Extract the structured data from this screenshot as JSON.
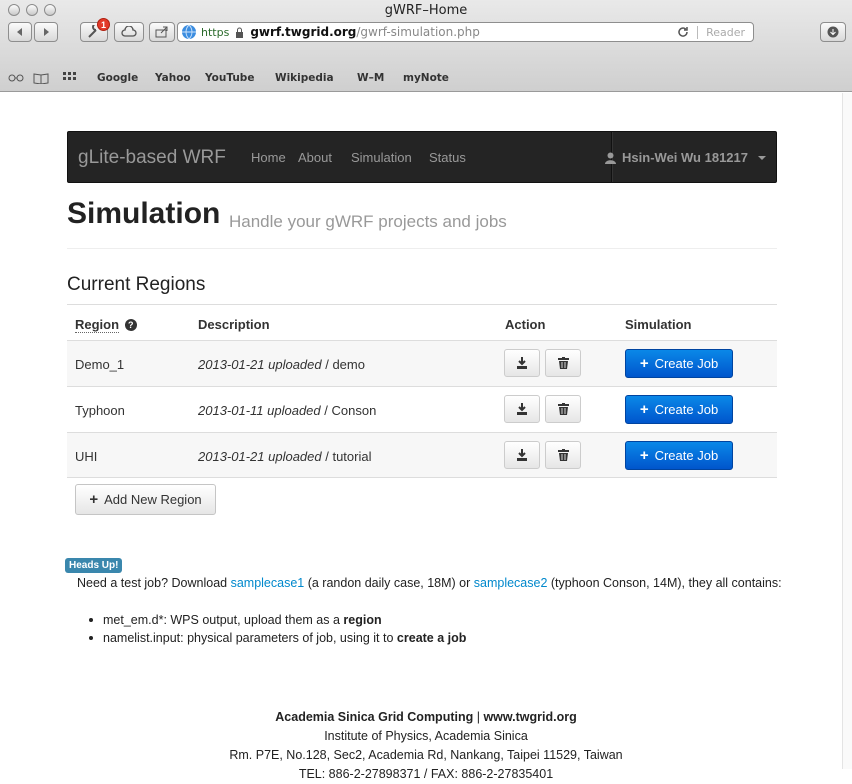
{
  "window": {
    "title": "gWRF–Home"
  },
  "toolbar": {
    "badge_count": "1",
    "url_scheme_label": "https",
    "url_host": "gwrf.twgrid.org",
    "url_path": "/gwrf-simulation.php",
    "reader_label": "Reader"
  },
  "bookmarks": [
    "Google",
    "Yahoo",
    "YouTube",
    "Wikipedia",
    "W–M",
    "myNote"
  ],
  "navbar": {
    "brand": "gLite-based WRF",
    "links": [
      "Home",
      "About",
      "Simulation",
      "Status"
    ],
    "user": "Hsin-Wei Wu 181217"
  },
  "header": {
    "title": "Simulation",
    "subtitle": "Handle your gWRF projects and jobs"
  },
  "regions": {
    "title": "Current Regions",
    "columns": [
      "Region",
      "Description",
      "Action",
      "Simulation"
    ],
    "rows": [
      {
        "region": "Demo_1",
        "date": "2013-01-21 uploaded",
        "sep": " / ",
        "desc": "demo",
        "create_label": "Create Job"
      },
      {
        "region": "Typhoon",
        "date": "2013-01-11 uploaded",
        "sep": " / ",
        "desc": "Conson",
        "create_label": "Create Job"
      },
      {
        "region": "UHI",
        "date": "2013-01-21 uploaded",
        "sep": " / ",
        "desc": "tutorial",
        "create_label": "Create Job"
      }
    ],
    "add_label": "Add New Region"
  },
  "heads_up": {
    "label": "Heads Up!",
    "text_1": "Need a test job? Download ",
    "link_1": "samplecase1",
    "text_2": " (a randon daily case, 18M) or ",
    "link_2": "samplecase2",
    "text_3": " (typhoon Conson, 14M), they all contains:",
    "bullet_1_text": "met_em.d*: WPS output, upload them as a ",
    "bullet_1_bold": "region",
    "bullet_2_text": "namelist.input: physical parameters of job, using it to ",
    "bullet_2_bold": "create a job"
  },
  "footer": {
    "org": "Academia Sinica Grid Computing",
    "sep": " | ",
    "site": "www.twgrid.org",
    "line2": "Institute of Physics, Academia Sinica",
    "line3": "Rm. P7E, No.128, Sec2, Academia Rd, Nankang, Taipei 11529, Taiwan",
    "line4": "TEL: 886-2-27898371 / FAX: 886-2-27835401"
  },
  "colors": {
    "navbar": "#242424",
    "primary": "#0066dd",
    "label_info": "#3a87ad",
    "link": "#0088cc"
  }
}
